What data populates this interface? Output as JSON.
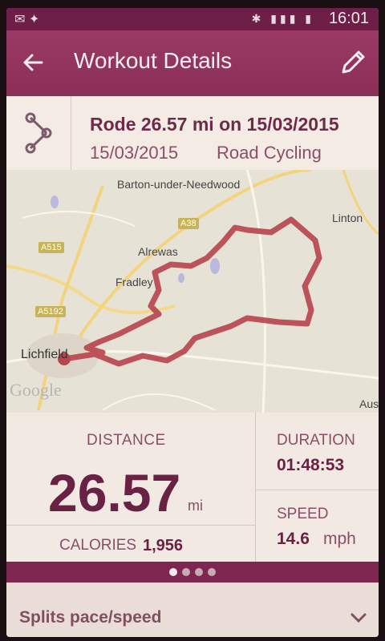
{
  "status_bar": {
    "time": "16:01"
  },
  "action_bar": {
    "title": "Workout Details"
  },
  "summary": {
    "title": "Rode 26.57 mi on 15/03/2015",
    "date": "15/03/2015",
    "activity_type": "Road Cycling"
  },
  "map": {
    "labels": {
      "barton": "Barton-under-Needwood",
      "linton": "Linton",
      "alrewas": "Alrewas",
      "fradley": "Fradley",
      "lichfield": "Lichfield",
      "aus": "Aus"
    },
    "roads": {
      "a38": "A38",
      "a515": "A515",
      "a5192": "A5192"
    },
    "attribution": "Google"
  },
  "stats": {
    "distance_label": "DISTANCE",
    "distance_value": "26.57",
    "distance_unit": "mi",
    "calories_label": "CALORIES",
    "calories_value": "1,956",
    "duration_label": "DURATION",
    "duration_value": "01:48:53",
    "speed_label": "SPEED",
    "speed_value": "14.6",
    "speed_unit": "mph"
  },
  "pager": {
    "active_index": 0,
    "count": 4
  },
  "splits": {
    "label": "Splits pace/speed"
  },
  "colors": {
    "brand": "#8a2f58",
    "route": "#b8454f"
  }
}
